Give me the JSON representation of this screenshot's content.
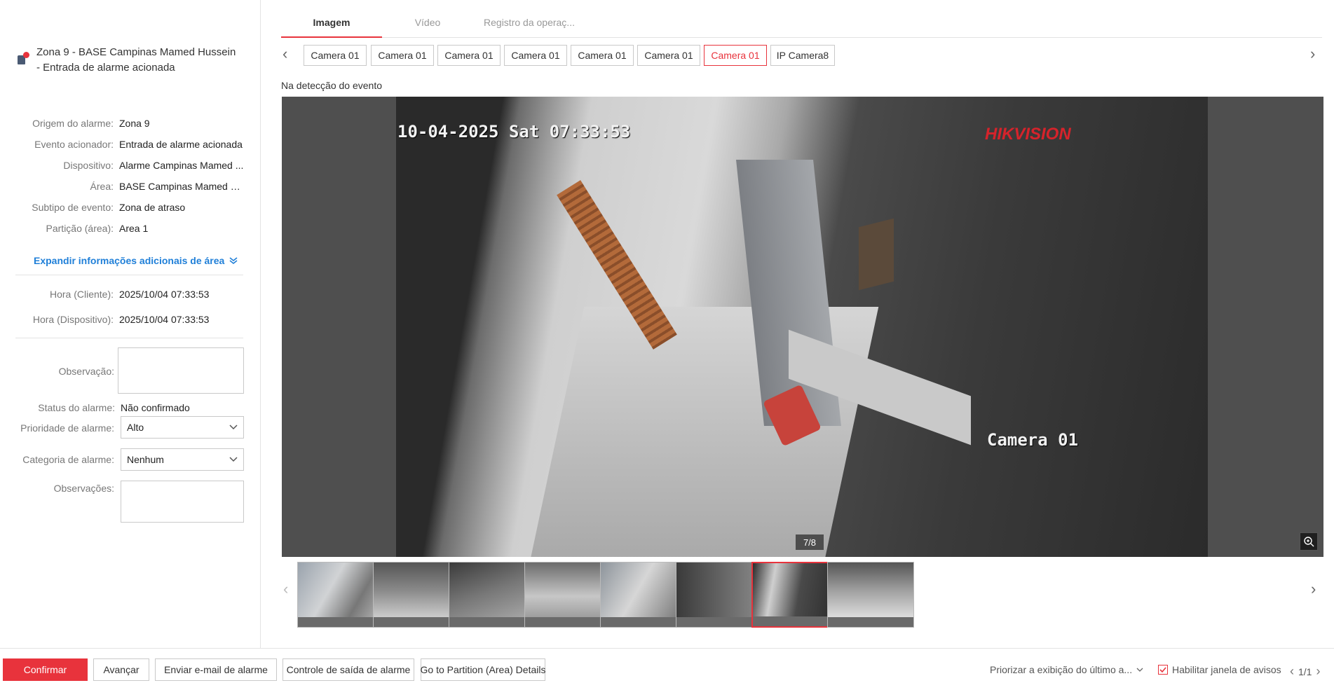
{
  "alarm": {
    "title": "Zona 9 - BASE Campinas Mamed Hussein - Entrada de alarme acionada"
  },
  "details": [
    {
      "label": "Origem do alarme:",
      "value": "Zona 9"
    },
    {
      "label": "Evento acionador:",
      "value": "Entrada de alarme acionada"
    },
    {
      "label": "Dispositivo:",
      "value": "Alarme Campinas Mamed ..."
    },
    {
      "label": "Área:",
      "value": "BASE Campinas Mamed H..."
    },
    {
      "label": "Subtipo de evento:",
      "value": "Zona de atraso"
    },
    {
      "label": "Partição (área):",
      "value": "Area 1"
    }
  ],
  "expand_label": "Expandir informações adicionais de área",
  "times": [
    {
      "label": "Hora (Cliente):",
      "value": "2025/10/04 07:33:53"
    },
    {
      "label": "Hora (Dispositivo):",
      "value": "2025/10/04 07:33:53"
    }
  ],
  "form": {
    "observacao_label": "Observação:",
    "status_label": "Status do alarme:",
    "status_value": "Não confirmado",
    "priority_label": "Prioridade de alarme:",
    "priority_value": "Alto",
    "category_label": "Categoria de alarme:",
    "category_value": "Nenhum",
    "observacoes_label": "Observações:"
  },
  "tabs": [
    {
      "label": "Imagem",
      "active": true
    },
    {
      "label": "Vídeo",
      "active": false
    },
    {
      "label": "Registro da operaç...",
      "active": false
    }
  ],
  "cameras": [
    {
      "label": "Camera 01",
      "active": false
    },
    {
      "label": "Camera 01",
      "active": false
    },
    {
      "label": "Camera 01",
      "active": false
    },
    {
      "label": "Camera 01",
      "active": false
    },
    {
      "label": "Camera 01",
      "active": false
    },
    {
      "label": "Camera 01",
      "active": false
    },
    {
      "label": "Camera 01",
      "active": true
    },
    {
      "label": "IP Camera8",
      "active": false
    }
  ],
  "viewer": {
    "caption": "Na detecção do evento",
    "osd_timestamp": "10-04-2025 Sat 07:33:53",
    "osd_camera": "Camera 01",
    "brand": "HIKVISION",
    "page_counter": "7/8"
  },
  "thumbnails": {
    "count": 8,
    "active_index": 6
  },
  "bottom": {
    "confirm": "Confirmar",
    "advance": "Avançar",
    "email": "Enviar e-mail de alarme",
    "output": "Controle de saída de alarme",
    "partition": "Go to Partition (Area) Details",
    "priority_display": "Priorizar a exibição do último a...",
    "enable_popup": "Habilitar janela de avisos",
    "pager": "1/1"
  },
  "colors": {
    "accent": "#e8333c",
    "link": "#1f7fd8"
  }
}
